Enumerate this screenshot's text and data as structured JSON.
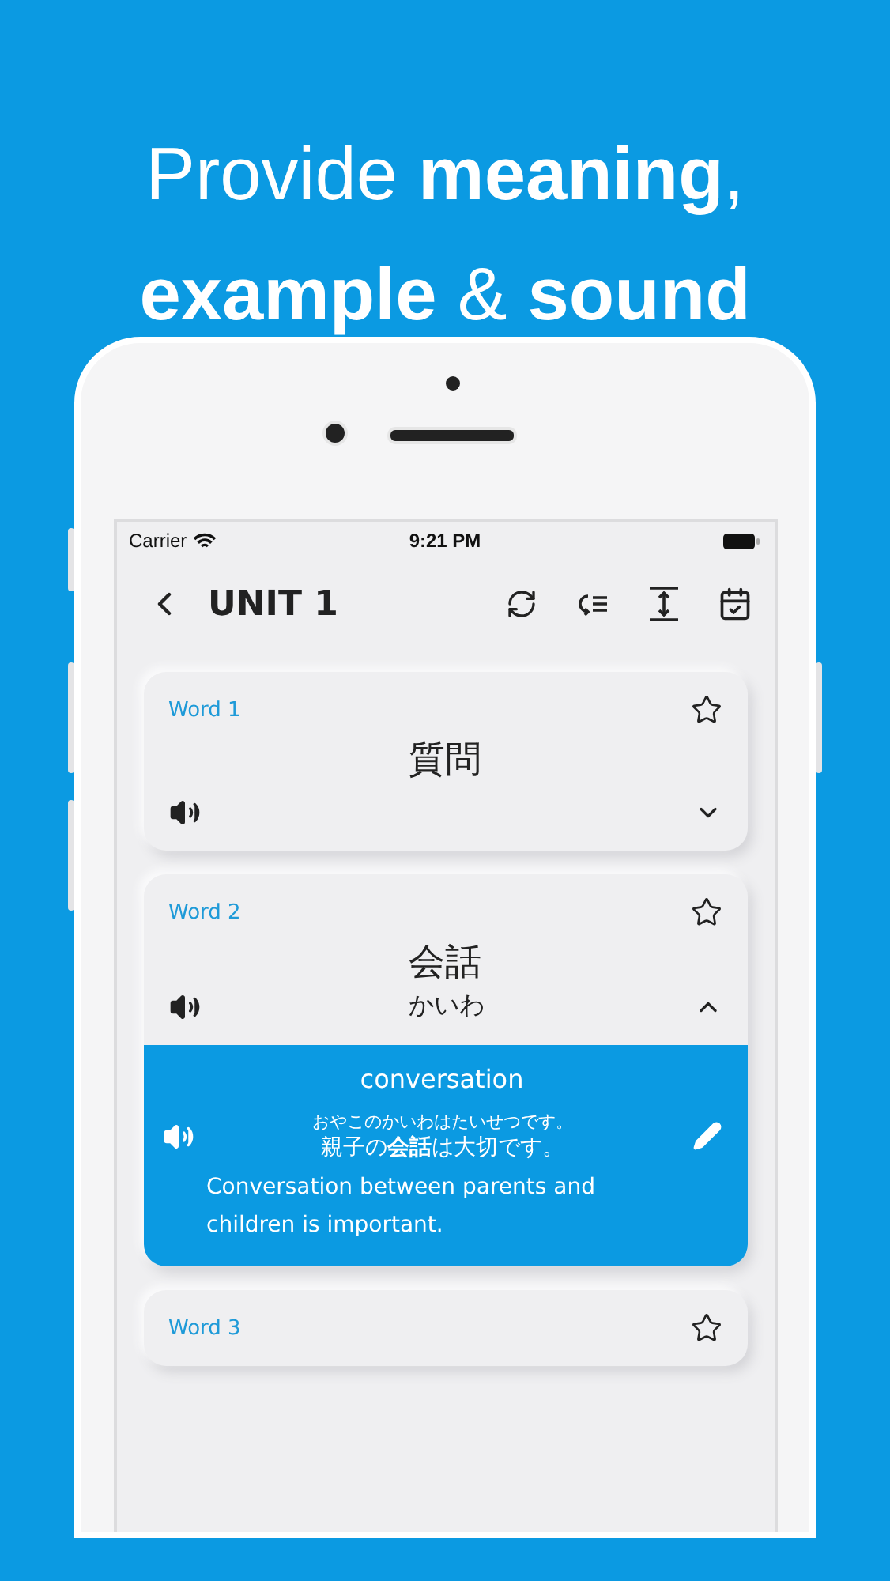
{
  "headline": {
    "lines": [
      "Provide **meaning**,",
      "**example** & **sound**"
    ]
  },
  "status_bar": {
    "carrier": "Carrier",
    "time": "9:21 PM"
  },
  "nav": {
    "title": "UNIT 1"
  },
  "cards": [
    {
      "label": "Word 1",
      "word": "質問",
      "starred": false,
      "expanded": false
    },
    {
      "label": "Word 2",
      "word": "会話",
      "reading": "かいわ",
      "starred": false,
      "expanded": true,
      "meaning": "conversation",
      "example_reading": "おやこのかいわはたいせつです。",
      "example": "親子の**会話**は大切です。",
      "translation": "Conversation between parents and children is important."
    },
    {
      "label": "Word 3",
      "starred": false,
      "expanded": false
    }
  ]
}
